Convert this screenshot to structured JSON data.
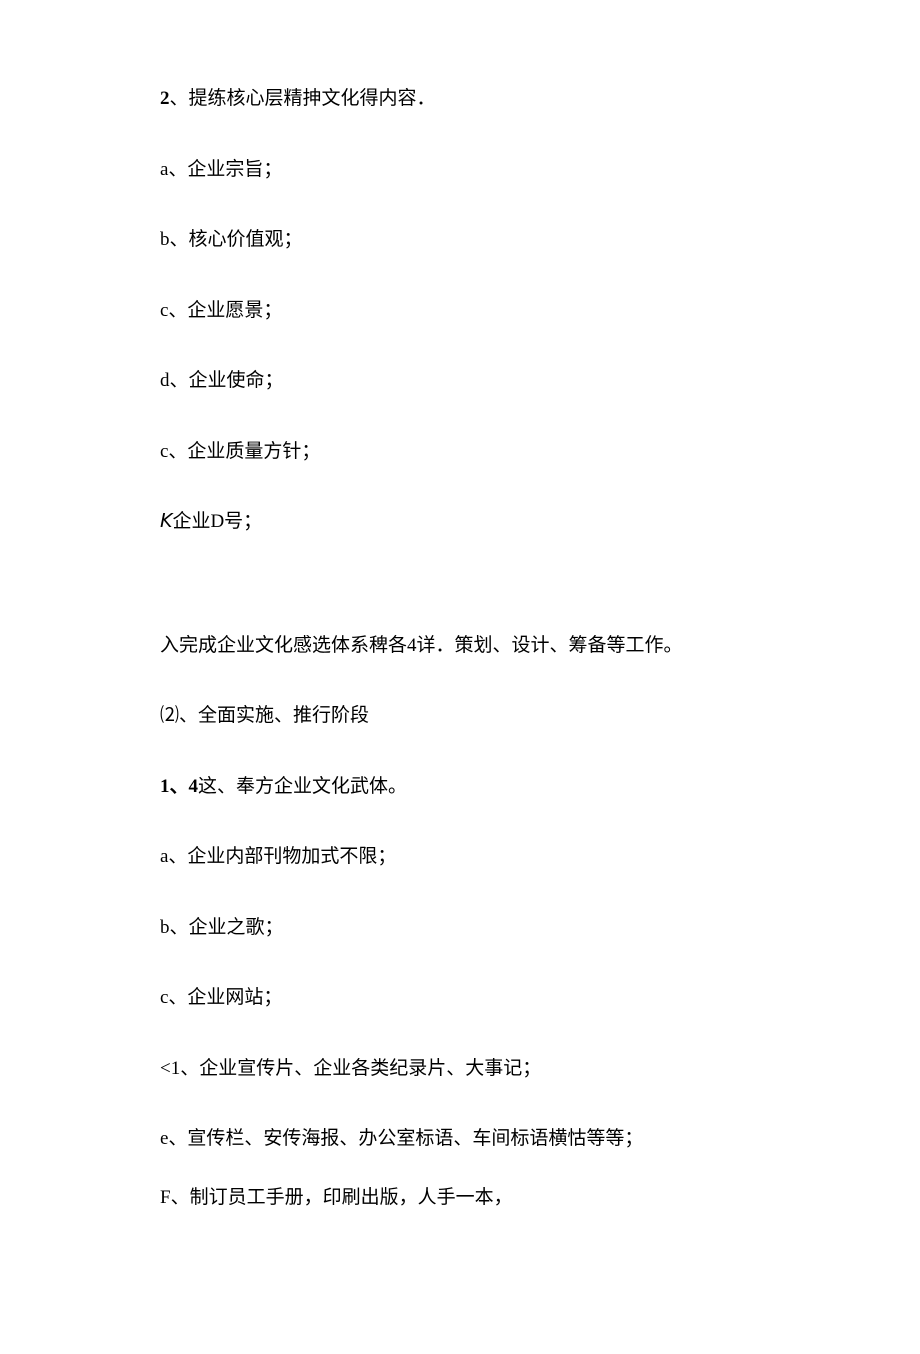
{
  "lines": [
    {
      "bold": "2",
      "rest": "、提练核心层精抻文化得内容．",
      "gap": "normal"
    },
    {
      "bold": "",
      "rest": "a、企业宗旨；",
      "gap": "normal"
    },
    {
      "bold": "",
      "rest": "b、核心价值观；",
      "gap": "normal"
    },
    {
      "bold": "",
      "rest": "c、企业愿景；",
      "gap": "normal"
    },
    {
      "bold": "",
      "rest": "d、企业使命；",
      "gap": "normal"
    },
    {
      "bold": "",
      "rest": "c、企业质量方针；",
      "gap": "normal"
    },
    {
      "bold": "",
      "rest": "𝘒企业D号；",
      "gap": "large"
    },
    {
      "bold": "",
      "rest": "入完成企业文化感选体系稗各4详．策划、设计、筹备等工作。",
      "gap": "normal"
    },
    {
      "bold": "",
      "rest": "⑵、全面实施、推行阶段",
      "gap": "normal"
    },
    {
      "bold": "1、4",
      "rest": "这、奉方企业文化武体。",
      "gap": "normal"
    },
    {
      "bold": "",
      "rest": "a、企业内部刊物加式不限；",
      "gap": "normal"
    },
    {
      "bold": "",
      "rest": "b、企业之歌；",
      "gap": "normal"
    },
    {
      "bold": "",
      "rest": "c、企业网站；",
      "gap": "normal"
    },
    {
      "bold": "",
      "rest": "<1、企业宣传片、企业各类纪录片、大事记；",
      "gap": "normal"
    },
    {
      "bold": "",
      "rest": "e、宣传栏、安传海报、办公室标语、车间标语横怙等等；",
      "gap": "small"
    },
    {
      "bold": "",
      "rest": "F、制订员工手册，印刷出版，人手一本，",
      "gap": "normal"
    }
  ]
}
